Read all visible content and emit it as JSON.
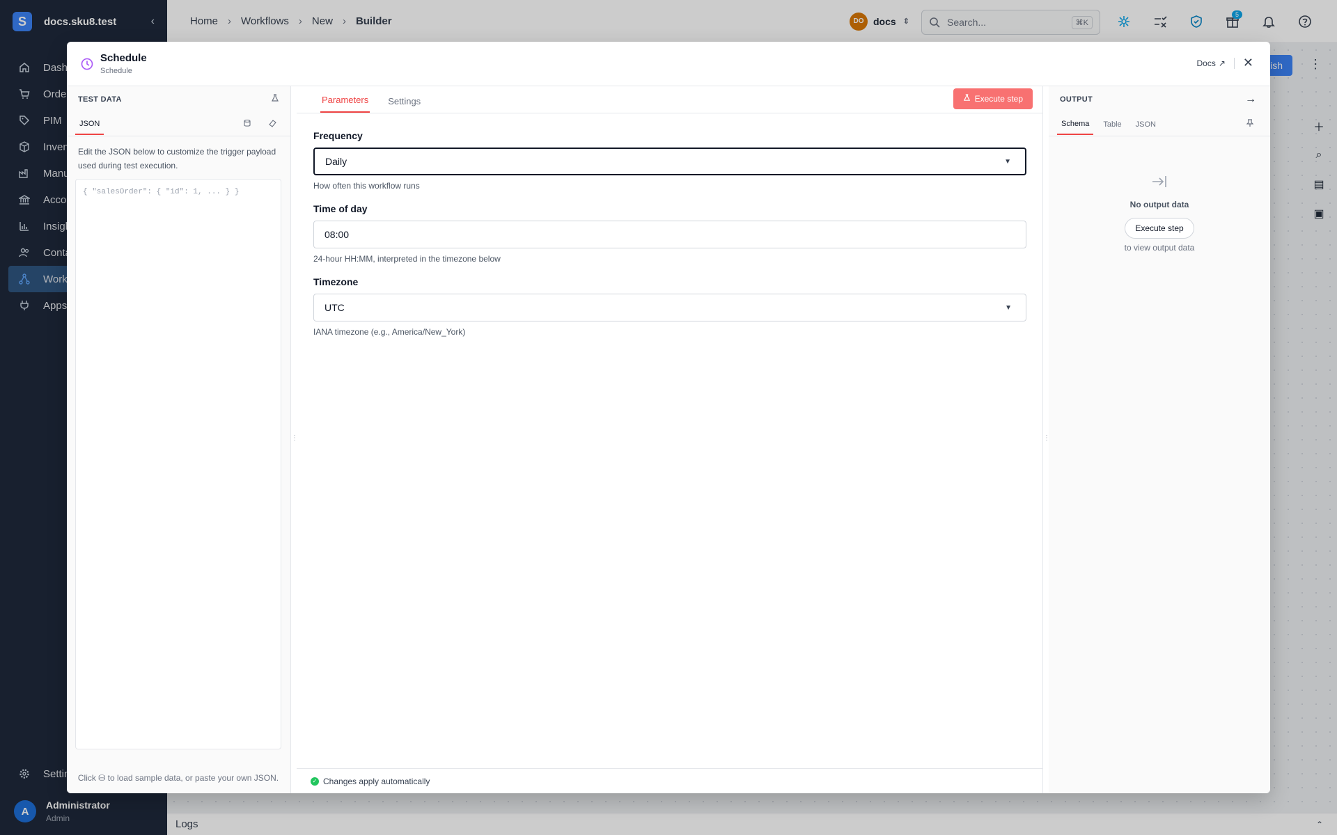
{
  "sidebar": {
    "workspace": "docs.sku8.test",
    "logo_letter": "S",
    "items": [
      {
        "label": "Dashb",
        "icon": "home-icon"
      },
      {
        "label": "Orders",
        "icon": "cart-icon"
      },
      {
        "label": "PIM",
        "icon": "tag-icon"
      },
      {
        "label": "Invent",
        "icon": "box-icon"
      },
      {
        "label": "Manuf",
        "icon": "factory-icon"
      },
      {
        "label": "Accou",
        "icon": "bank-icon"
      },
      {
        "label": "Insigh",
        "icon": "chart-icon"
      },
      {
        "label": "Conta",
        "icon": "users-icon"
      },
      {
        "label": "Work",
        "icon": "workflow-icon"
      },
      {
        "label": "Apps",
        "icon": "plug-icon"
      }
    ],
    "settings_label": "Settin",
    "user": {
      "initial": "A",
      "name": "Administrator",
      "role": "Admin"
    }
  },
  "topbar": {
    "breadcrumbs": [
      "Home",
      "Workflows",
      "New",
      "Builder"
    ],
    "org_badge": "DO",
    "org_name": "docs",
    "search_placeholder": "Search...",
    "search_shortcut": "⌘K",
    "notification_count": "5"
  },
  "canvas": {
    "publish_label": "ish",
    "logs_label": "Logs"
  },
  "modal": {
    "title": "Schedule",
    "subtitle": "Schedule",
    "docs_label": "Docs",
    "left": {
      "title": "TEST DATA",
      "tab": "JSON",
      "description": "Edit the JSON below to customize the trigger payload used during test execution.",
      "placeholder": "{ \"salesOrder\": { \"id\": 1, ... } }",
      "footer_pre": "Click",
      "footer_post": "to load sample data, or paste your own JSON."
    },
    "center": {
      "tabs": [
        "Parameters",
        "Settings"
      ],
      "execute_label": "Execute step",
      "fields": [
        {
          "label": "Frequency",
          "value": "Daily",
          "help": "How often this workflow runs"
        },
        {
          "label": "Time of day",
          "value": "08:00",
          "help": "24-hour HH:MM, interpreted in the timezone below"
        },
        {
          "label": "Timezone",
          "value": "UTC",
          "help": "IANA timezone (e.g., America/New_York)"
        }
      ],
      "footer": "Changes apply automatically"
    },
    "right": {
      "title": "OUTPUT",
      "tabs": [
        "Schema",
        "Table",
        "JSON"
      ],
      "empty_title": "No output data",
      "empty_button": "Execute step",
      "empty_sub": "to view output data"
    }
  }
}
